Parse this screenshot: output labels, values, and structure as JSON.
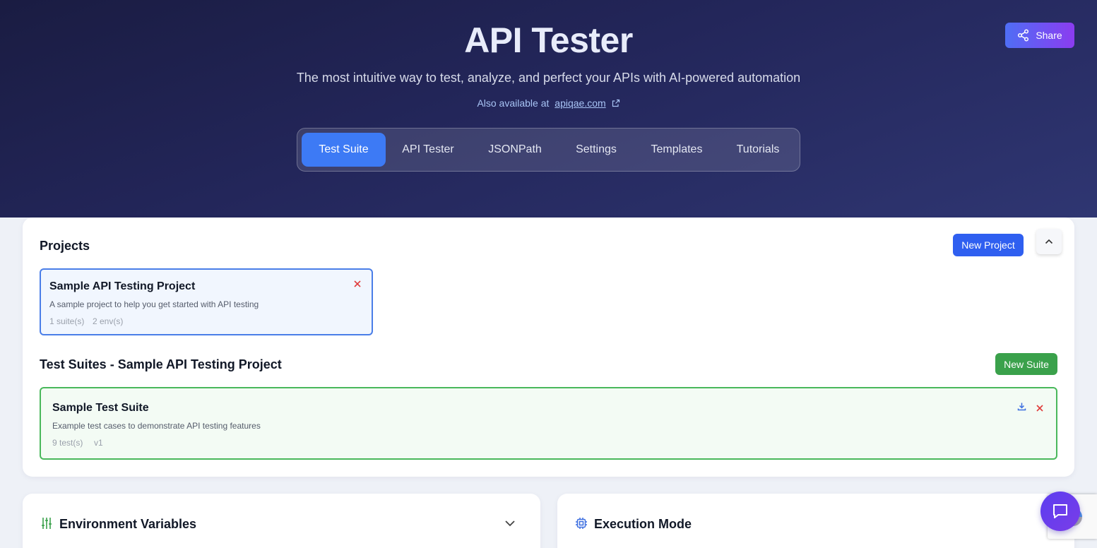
{
  "header": {
    "title": "API Tester",
    "subtitle": "The most intuitive way to test, analyze, and perfect your APIs with AI-powered automation",
    "also_available_prefix": "Also available at",
    "also_available_link": "apiqae.com",
    "share_label": "Share"
  },
  "tabs": [
    {
      "label": "Test Suite",
      "active": true
    },
    {
      "label": "API Tester",
      "active": false
    },
    {
      "label": "JSONPath",
      "active": false
    },
    {
      "label": "Settings",
      "active": false
    },
    {
      "label": "Templates",
      "active": false
    },
    {
      "label": "Tutorials",
      "active": false
    }
  ],
  "projects": {
    "title": "Projects",
    "new_button": "New Project",
    "items": [
      {
        "name": "Sample API Testing Project",
        "description": "A sample project to help you get started with API testing",
        "suites": "1 suite(s)",
        "envs": "2 env(s)"
      }
    ]
  },
  "suites": {
    "title": "Test Suites - Sample API Testing Project",
    "new_button": "New Suite",
    "items": [
      {
        "name": "Sample Test Suite",
        "description": "Example test cases to demonstrate API testing features",
        "tests": "9 test(s)",
        "version": "v1"
      }
    ]
  },
  "panels": {
    "environment": "Environment Variables",
    "execution": "Execution Mode"
  },
  "colors": {
    "accent": "#3d7af5",
    "primary_button": "#2f5ff0",
    "success": "#3aa14b",
    "danger": "#e03a3a"
  }
}
